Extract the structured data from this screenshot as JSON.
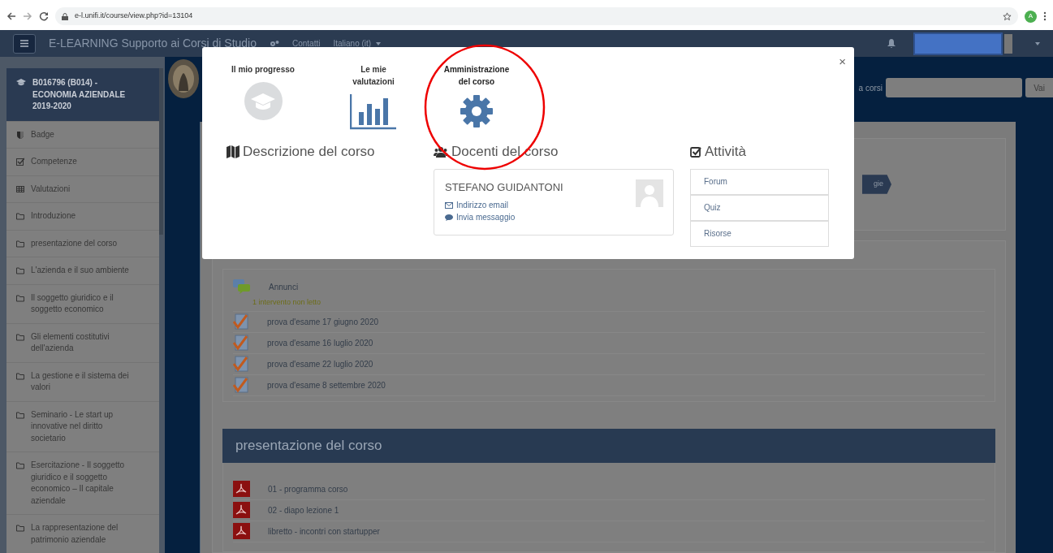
{
  "browser": {
    "url": "e-l.unifi.it/course/view.php?id=13104",
    "avatar_letter": "A"
  },
  "navbar": {
    "title": "E-LEARNING Supporto ai Corsi di Studio",
    "links": [
      "Contatti",
      "Italiano (it)"
    ]
  },
  "sidebar": {
    "course_title": "B016796 (B014) - ECONOMIA AZIENDALE 2019-2020",
    "items": [
      {
        "kind": "badge",
        "label": "Badge"
      },
      {
        "kind": "competence",
        "label": "Competenze"
      },
      {
        "kind": "grades",
        "label": "Valutazioni"
      },
      {
        "kind": "folder",
        "label": "Introduzione"
      },
      {
        "kind": "folder",
        "label": "presentazione del corso"
      },
      {
        "kind": "folder",
        "label": "L'azienda e il suo ambiente"
      },
      {
        "kind": "folder",
        "label": "Il soggetto giuridico e il soggetto economico"
      },
      {
        "kind": "folder",
        "label": "Gli elementi costitutivi dell'azienda"
      },
      {
        "kind": "folder",
        "label": "La gestione e il sistema dei valori"
      },
      {
        "kind": "folder",
        "label": "Seminario - Le start up innovative nel diritto societario"
      },
      {
        "kind": "folder",
        "label": "Esercitazione - Il soggetto giuridico e il soggetto economico – Il capitale aziendale"
      },
      {
        "kind": "folder",
        "label": "La rappresentazione del patrimonio aziendale"
      }
    ]
  },
  "search": {
    "label": "a corsi",
    "button": "Vai"
  },
  "breadcrumb_fragment": "gie",
  "sections": [
    {
      "items": [
        {
          "kind": "forum",
          "label": "Annunci",
          "note": "1 intervento non letto"
        },
        {
          "kind": "quiz",
          "label": "prova d'esame 17 giugno 2020"
        },
        {
          "kind": "quiz",
          "label": "prova d'esame 16 luglio 2020"
        },
        {
          "kind": "quiz",
          "label": "prova d'esame 22 luglio 2020"
        },
        {
          "kind": "quiz",
          "label": "prova d'esame 8 settembre 2020"
        }
      ]
    },
    {
      "title": "presentazione del corso",
      "items": [
        {
          "kind": "pdf",
          "label": "01 - programma corso"
        },
        {
          "kind": "pdf",
          "label": "02 - diapo lezione 1"
        },
        {
          "kind": "pdf",
          "label": "libretto - incontri con startupper"
        }
      ]
    }
  ],
  "modal": {
    "close": "×",
    "shortcuts": [
      {
        "kind": "progress",
        "label": "Il mio progresso",
        "highlighted": false
      },
      {
        "kind": "grades",
        "label": "Le mie valutazioni",
        "highlighted": false
      },
      {
        "kind": "admin",
        "label": "Amministrazione del corso",
        "highlighted": true
      }
    ],
    "description_heading": "Descrizione del corso",
    "teachers_heading": "Docenti del corso",
    "teacher": {
      "name": "STEFANO GUIDANTONI",
      "links": [
        {
          "kind": "email",
          "label": "Indirizzo email"
        },
        {
          "kind": "message",
          "label": "Invia messaggio"
        }
      ]
    },
    "activities_heading": "Attività",
    "activities": [
      "Forum",
      "Quiz",
      "Risorse"
    ]
  }
}
